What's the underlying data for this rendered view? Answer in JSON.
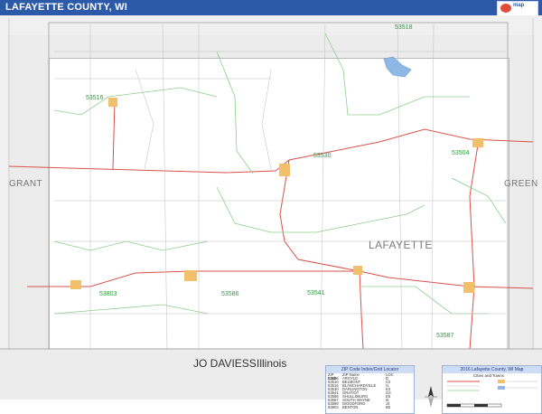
{
  "title": "LAFAYETTE COUNTY, WI",
  "brand": {
    "logo_text": "map"
  },
  "regions": {
    "county": "LAFAYETTE",
    "west": "GRANT",
    "east": "GREEN",
    "south_county": "JO DAVIESS",
    "south_state": "Illinois"
  },
  "zip_labels": [
    "53518",
    "53516",
    "53530",
    "53504",
    "53803",
    "53586",
    "53541",
    "53587"
  ],
  "legend": {
    "title": "ZIP Code Index/Grid Locator",
    "columns": [
      "ZIP Code",
      "ZIP Name",
      "LOC"
    ],
    "rows": [
      [
        "53504",
        "ARGYLE",
        "D"
      ],
      [
        "53510",
        "BELMONT",
        "C2"
      ],
      [
        "53516",
        "BLANCHARDVILLE",
        "I1"
      ],
      [
        "53530",
        "DARLINGTON",
        "E3"
      ],
      [
        "53541",
        "GRATIOT",
        "G3"
      ],
      [
        "53586",
        "SHULLSBURG",
        "E5"
      ],
      [
        "53587",
        "SOUTH WAYNE",
        "I5"
      ],
      [
        "53599",
        "WOODFORD",
        "J4"
      ],
      [
        "53803",
        "BENTON",
        "B5"
      ]
    ]
  },
  "zip_map_box": {
    "title": "2016 Lafayette County, WI Map",
    "subtitle": "Cities and Towns"
  }
}
